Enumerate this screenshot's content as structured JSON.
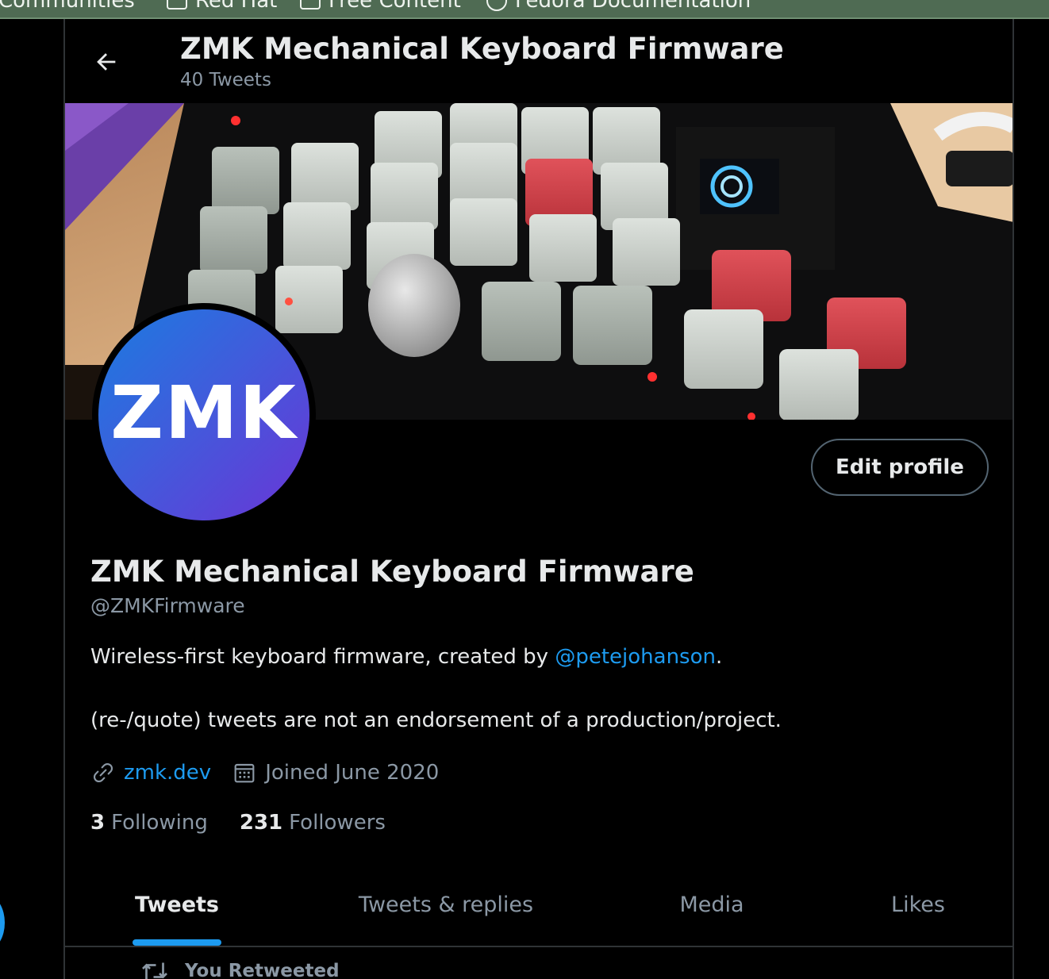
{
  "bookmarks": [
    {
      "label": "Communities",
      "icon": "none"
    },
    {
      "label": "Red Hat",
      "icon": "folder-icon"
    },
    {
      "label": "Free Content",
      "icon": "folder-icon"
    },
    {
      "label": "Fedora Documentation",
      "icon": "globe-icon"
    }
  ],
  "header": {
    "title": "ZMK Mechanical Keyboard Firmware",
    "tweet_count": "40 Tweets",
    "back_icon": "arrow-left-icon"
  },
  "banner": {
    "subject": "split mechanical keyboard photo"
  },
  "avatar": {
    "text": "ZMK"
  },
  "edit_profile_label": "Edit profile",
  "profile": {
    "name": "ZMK Mechanical Keyboard Firmware",
    "handle": "@ZMKFirmware",
    "bio_line1_prefix": "Wireless-first keyboard firmware, created by ",
    "bio_mention": "@petejohanson",
    "bio_line1_suffix": ".",
    "bio_line2": "(re-/quote) tweets are not an endorsement of a production/project.",
    "website": "zmk.dev",
    "joined": "Joined June 2020",
    "following_count": "3",
    "following_label": "Following",
    "followers_count": "231",
    "followers_label": "Followers"
  },
  "tabs": [
    "Tweets",
    "Tweets & replies",
    "Media",
    "Likes"
  ],
  "active_tab": "Tweets",
  "retweet_label": "You Retweeted",
  "colors": {
    "accent": "#1d9bf0",
    "background": "#000000",
    "muted_text": "#8b98a5",
    "bookmarks_bar": "#4f6b53"
  }
}
